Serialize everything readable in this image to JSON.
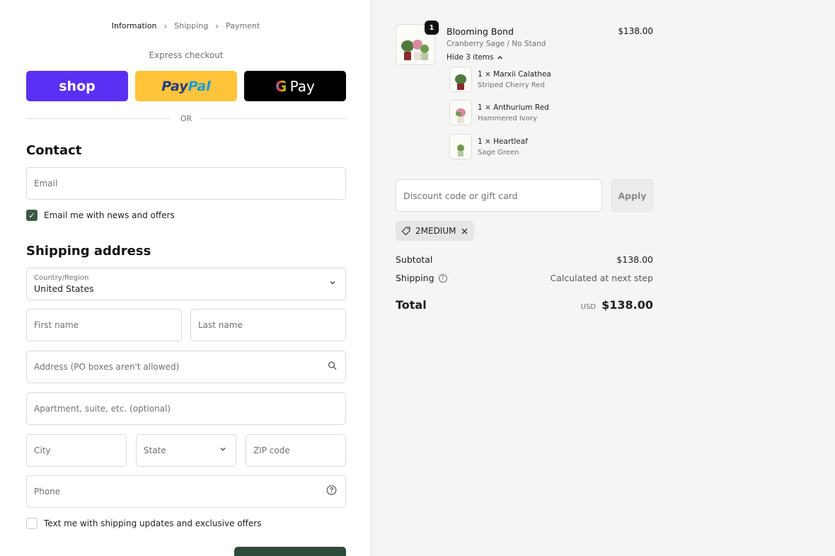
{
  "breadcrumb": {
    "items": [
      "Information",
      "Shipping",
      "Payment"
    ]
  },
  "express": {
    "label": "Express checkout",
    "shop": "shop",
    "paypal_a": "Pay",
    "paypal_b": "Pal",
    "gpay_g": "G",
    "gpay_text": "Pay",
    "or": "OR"
  },
  "contact": {
    "heading": "Contact",
    "email_placeholder": "Email",
    "news_label": "Email me with news and offers"
  },
  "shipping": {
    "heading": "Shipping address",
    "country_label": "Country/Region",
    "country_value": "United States",
    "first_name": "First name",
    "last_name": "Last name",
    "address": "Address (PO boxes aren't allowed)",
    "apartment": "Apartment, suite, etc. (optional)",
    "city": "City",
    "state": "State",
    "zip": "ZIP code",
    "phone": "Phone",
    "sms_label": "Text me with shipping updates and exclusive offers"
  },
  "cart": {
    "product": {
      "qty": "1",
      "title": "Blooming Bond",
      "variant": "Cranberry Sage / No Stand",
      "hide_items": "Hide 3 items",
      "price": "$138.00"
    },
    "items": [
      {
        "name": "1 × Marxii Calathea",
        "variant": "Striped Cherry Red"
      },
      {
        "name": "1 × Anthurium Red",
        "variant": "Hammered Ivory"
      },
      {
        "name": "1 × Heartleaf",
        "variant": "Sage Green"
      }
    ]
  },
  "discount": {
    "placeholder": "Discount code or gift card",
    "apply": "Apply",
    "code": "2MEDIUM"
  },
  "summary": {
    "subtotal_label": "Subtotal",
    "subtotal_value": "$138.00",
    "shipping_label": "Shipping",
    "shipping_value": "Calculated at next step",
    "total_label": "Total",
    "currency": "USD",
    "total_value": "$138.00"
  },
  "colors": {
    "shop": "#5a31f4",
    "paypal": "#ffc439",
    "gpay": "#000000",
    "accent": "#3b5a45"
  }
}
